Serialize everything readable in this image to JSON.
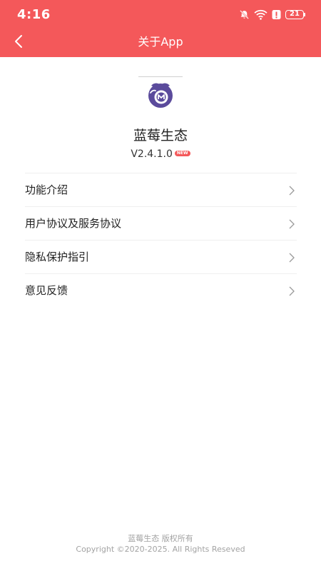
{
  "status_bar": {
    "time": "4:16",
    "battery": "21",
    "icons": [
      "bell-off-icon",
      "wifi-icon",
      "alert-icon",
      "battery-icon"
    ]
  },
  "header": {
    "title": "关于App",
    "back_icon": "chevron-left-icon"
  },
  "app": {
    "name": "蓝莓生态",
    "version": "V2.4.1.0",
    "badge": "NEW",
    "logo_icon": "blueberry-logo"
  },
  "menu": {
    "items": [
      {
        "label": "功能介绍"
      },
      {
        "label": "用户协议及服务协议"
      },
      {
        "label": "隐私保护指引"
      },
      {
        "label": "意见反馈"
      }
    ],
    "arrow_icon": "chevron-right-icon"
  },
  "footer": {
    "owner": "蓝莓生态 版权所有",
    "copyright": "Copyright ©2020-2025. All Rights Reseved"
  },
  "colors": {
    "header": "#f4585a",
    "logo": "#5b4b9c",
    "badge": "#f4585a"
  }
}
